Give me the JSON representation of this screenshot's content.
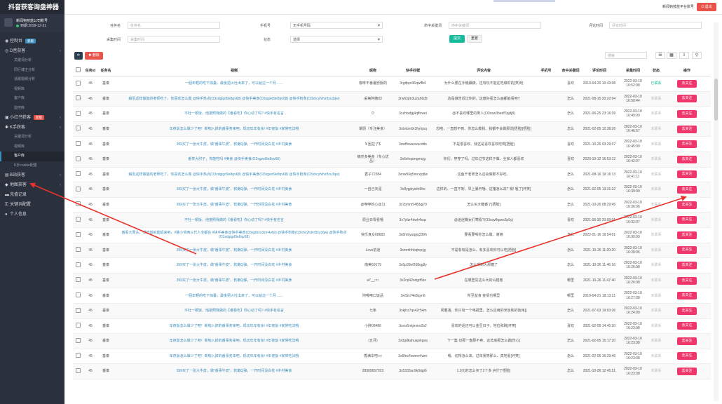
{
  "app": {
    "title": "抖音获客询盘神器"
  },
  "user": {
    "name": "新闻钩技蓝公司账号",
    "expiry": "到期:2099-12-31"
  },
  "topbar": {
    "welcome": "新闻钩技蓝平台账号",
    "logout": "退出"
  },
  "sidebar": {
    "items": [
      {
        "label": "控制台",
        "tag": "新版",
        "tag_color": "#3c8dbc"
      },
      {
        "label": "D音获客"
      },
      {
        "label": "关键词分析"
      },
      {
        "label": "同行博主分析"
      },
      {
        "label": "话题视频分析"
      },
      {
        "label": "视频库"
      },
      {
        "label": "客户库"
      },
      {
        "label": "监控库"
      },
      {
        "label": "小红书获客",
        "tag": "新版",
        "tag_color": "#e8534a"
      },
      {
        "label": "K手获客"
      },
      {
        "label": "关键词分析"
      },
      {
        "label": "视频库"
      },
      {
        "label": "客户库"
      },
      {
        "label": "K手cookie配置"
      },
      {
        "label": "B站获客"
      },
      {
        "label": "地图获客"
      },
      {
        "label": "充值记录"
      },
      {
        "label": "关键词配置"
      },
      {
        "label": "个人信息"
      }
    ]
  },
  "search": {
    "task_label": "任务名",
    "task_placeholder": "任务名",
    "phone_label": "手机号",
    "phone_value": "无手机号码",
    "keyword_label": "命中关键词",
    "keyword_placeholder": "命中关键词",
    "comment_time_label": "评论时间",
    "comment_time_placeholder": "评论时间",
    "collect_time_label": "采集时间",
    "collect_time_placeholder": "采集时间",
    "status_label": "状态",
    "status_value": "选择",
    "submit": "提交",
    "reset": "重置"
  },
  "toolbar": {
    "refresh": "⟳",
    "delete": "删除",
    "search_placeholder": "搜索"
  },
  "table": {
    "headers": [
      "",
      "任务id",
      "任务名",
      "视频",
      "昵称",
      "快手抖號",
      "评论内容",
      "手机号",
      "命中关键词",
      "评论时间",
      "采集时间",
      "状态",
      "操作"
    ],
    "action_label": "去关注",
    "rows": [
      {
        "id": "45",
        "task": "垂奏",
        "video": "一個年輕的吃下烛臺，最後把火吐出來了，可以給這一个月……",
        "nick": "咖啡不番薯舒服的",
        "uid": "3rgtfppr36qwffb4",
        "comment": "为什么要在手機續錄，还有玩不能在吃綠財的[笑哭]",
        "kw": "喜欢",
        "ctime": "2019-04-20 10:43:08",
        "gtime": "2022-03-10 16:52:08",
        "status": "已联系",
        "status_on": true
      },
      {
        "id": "45",
        "task": "垂奏",
        "video": "解氢这样做能的老师吃了，你喜欢怎么做 @快手热点(O3xdgigd9e8qv68) @快手美食(O3xgwd9e8qv68) @快手粉条(O3xhcyfvfvr8zu3qw)",
        "nick": "采斋阿姨93",
        "uid": "3rw63ph3u2a56d9",
        "comment": "这是谁告诉过你的，这盘好看怎么画都能看吧?",
        "kw": "怎么",
        "ctime": "2021-08-15 20:22:04",
        "gtime": "2022-03-10 16:50:44",
        "status": "未联系",
        "status_on": false
      },
      {
        "id": "45",
        "task": "垂奏",
        "video": "不吐一顿饭，他按照我做的【番看吃】你心动了吗? #快手有名言",
        "nick": "D",
        "uid": "3xzhtxdgj4qffowei",
        "comment": "@不喜欢哪里的男人(O3xsw3bedf7pjdj8)",
        "kw": "怎么",
        "ctime": "2021-06-25 23:16:39",
        "gtime": "2022-03-10 16:49:09",
        "status": "未联系",
        "status_on": false
      },
      {
        "id": "45",
        "task": "垂奏",
        "video": "年夜饭怎么做少了吧！新喘入掉的番事务来吧，现切年年有余! #年夜饭 #家常吃法哦",
        "nick": "掌厨（专注美食）",
        "uid": "3xbnbm9r3fyrkjsq",
        "comment": "恐啦，一直想不到、你怎么教我、我都不会做那烫[捂脸][捂脸]",
        "kw": "怎么",
        "ctime": "2021-02-05 12:38:26",
        "gtime": "2022-03-10 16:46:57",
        "status": "未联系",
        "status_on": false
      },
      {
        "id": "45",
        "task": "垂奏",
        "video": "399买了一张大牛皮，做“番事牛皮”，软嫩Q弹，一开时间没白花 #乡村美食",
        "nick": "¥ 困拉了$",
        "uid": "3xwffxwavwucdds",
        "comment": "不是很喜欢、我还是喜欢喜欢吃啊[捂脸]",
        "kw": "喜欢",
        "ctime": "2021-10-26 03:29:37",
        "gtime": "2022-03-10 16:45:09",
        "status": "未联系",
        "status_on": false
      },
      {
        "id": "45",
        "task": "垂奏",
        "video": "番茶大肘子，你能吃吗 #美食 @快手美食(O3xgwd9e8qv68)",
        "nick": "楠杰多美食（专心优品）",
        "uid": "3x6xhqamgmcjg",
        "comment": "你们，穿穿了吗，过年过节这样子做、全家人都喜欢",
        "kw": "喜欢",
        "ctime": "2020-10-12 16:53:12",
        "gtime": "2022-03-10 16:42:07",
        "status": "未联系",
        "status_on": false
      },
      {
        "id": "45",
        "task": "垂奏",
        "video": "解氢这样做能的老师吃了，你喜欢怎么做 @快手热点(O3xdgigd9e8qv68) @快手美食(O3xgwd9e8qv68) @快手粉条(O3xhcyfvfvr8zu3qw)",
        "nick": "君子72384",
        "uid": "3xnw56q5mcxjq8w",
        "comment": "这鱼干老师怎么这会做那不好吃。",
        "kw": "怎么",
        "ctime": "2021-08-16 19:16:13",
        "gtime": "2022-03-10 16:41:11",
        "status": "未联系",
        "status_on": false
      },
      {
        "id": "45",
        "task": "垂奏",
        "video": "399买了一张大牛皮，做“番事牛皮”，软嫩Q弹，一开时间没白花 #乡村美食",
        "nick": "一自己天涯",
        "uid": "3x8ygpiyisht9he",
        "comment": "这样的、一直不到、早上暴开哦、这猪怎么来? 嘿! 喔了[坏笑]",
        "kw": "怎么",
        "ctime": "2021-02-05 13:31:22",
        "gtime": "2022-03-10 16:39:09",
        "status": "未联系",
        "status_on": false
      },
      {
        "id": "45",
        "task": "垂奏",
        "video": "399买了一张大牛皮，做“番事牛皮”，软嫩Q弹，一开时间没白花 #乡村美食",
        "nick": "@咿咿的心@11",
        "uid": "3x7pmm5483gj79",
        "comment": "怎么买大糖番了[捂脸]",
        "kw": "怎么",
        "ctime": "2021-10-26 08:29:45",
        "gtime": "2022-03-10 16:36:06",
        "status": "未联系",
        "status_on": false
      },
      {
        "id": "45",
        "task": "垂奏",
        "video": "不吐一顿饭，他按照我做的【番看吃】你心动了吗? #快手有名言",
        "nick": "原业日零看嘻",
        "uid": "3x7yfzr4dwh4sqc",
        "comment": "@迷迷糊女们莺看?(O3xqvfkpws2p9y)",
        "kw": "喜欢",
        "ctime": "2021-06-30 20:09:01",
        "gtime": "2022-03-10 16:32:07",
        "status": "未联系",
        "status_on": false
      },
      {
        "id": "45",
        "task": "垂奏",
        "video": "番看大果头，想吃饭就能起来吧，#整小爷两三代人全都在 #快手美食@快手美食(O3xgtbxx3xm4yfw) @快手粉条(O3xhcyfvfvr8zu3qw) @快手热点(O3xdgigd9e8qv68)",
        "nick": "快乐真女68683",
        "uid": "3x8mbyuqgq339h",
        "comment": "要看要喝你怎么做、谢谢",
        "kw": "怎么",
        "ctime": "2022-01-16 19:54:01",
        "gtime": "2022-03-10 16:30:09",
        "status": "未联系",
        "status_on": false
      },
      {
        "id": "45",
        "task": "垂奏",
        "video": "399买了一张大牛皮，做“番事牛皮”，软嫩Q弹，一开时间没白花 #乡村美食",
        "nick": "Love前道",
        "uid": "3xmmhhbqhqcjg",
        "comment": "不是有有是怎么，有多喜欢你可以吃[捂脸]",
        "kw": "怎么",
        "ctime": "2021-10-26 11:20:20",
        "gtime": "2022-03-10 16:28:06",
        "status": "未联系",
        "status_on": false
      },
      {
        "id": "45",
        "task": "垂奏",
        "video": "399买了一张大牛皮，做“番事牛皮”，软嫩Q弹，一开时间没白花 #乡村美食",
        "nick": "南美59179",
        "uid": "3x5p39nf268qg8y",
        "comment": "怎么喝到大那糖了",
        "kw": "怎么",
        "ctime": "2021-10-26 11:46:16",
        "gtime": "2022-03-10 16:26:08",
        "status": "未联系",
        "status_on": false
      },
      {
        "id": "45",
        "task": "垂奏",
        "video": "399买了一张大牛皮，做“番事牛皮”，软嫩Q弹，一开时间没白花 #乡村美食",
        "nick": "a7__□□",
        "uid": "3x2cp42sdgd5bx",
        "comment": "在哪里买这么大的山楂卷",
        "kw": "哪里",
        "ctime": "2021-10-26 11:47:40",
        "gtime": "2022-03-10 16:26:08",
        "status": "未联系",
        "status_on": false
      },
      {
        "id": "45",
        "task": "垂奏",
        "video": "一個年輕的吃下烛臺，最後把火吐出來了，可以給這一个月……",
        "nick": "阿哦嗦口饭品",
        "uid": "3xr5ix74e8qyn6",
        "comment": "所至盆食 金情也哪里",
        "kw": "哪里",
        "ctime": "2019-04-21 18:13:21",
        "gtime": "2022-03-10 16:27:08",
        "status": "未联系",
        "status_on": false
      },
      {
        "id": "45",
        "task": "垂奏",
        "video": "不吐一顿饭，他按照我做的【番看吃】你心动了吗? #快手有名言",
        "nick": "七条",
        "uid": "3xkjhz7qs42r54m",
        "comment": "闲着凑、你只有一个电视里，怎么应用的米饭和的饭用[]",
        "kw": "怎么",
        "ctime": "2021-07-03 19:03:36",
        "gtime": "2022-03-10 16:24:09",
        "status": "未联系",
        "status_on": false
      },
      {
        "id": "45",
        "task": "垂奏",
        "video": "年夜饭怎么做少了吧！新喘入掉的番事务来吧，现切年年有余! #年夜饭 #家常吃法哦",
        "nick": "小胖08486",
        "uid": "3xmr5nkjmmx2b2",
        "comment": "喜欢的话还可以金豆日子，地位和碗[坏笑]",
        "kw": "喜欢",
        "ctime": "2021-02-05 14:40:20",
        "gtime": "2022-03-10 16:23:08",
        "status": "未联系",
        "status_on": false
      },
      {
        "id": "45",
        "task": "垂奏",
        "video": "年夜饭怎么做少了吧！新喘入掉的番事务来吧，现切年年有余! #年夜饭 #家常吃法哦",
        "nick": "(五月)",
        "uid": "3x3gdkahuajvkgsq",
        "comment": "下一集 切那一盘那不卖、这年底那怎么做[伤心]",
        "kw": "怎么",
        "ctime": "2021-02-05 15:17:20",
        "gtime": "2022-03-10 16:23:08",
        "status": "未联系",
        "status_on": false
      },
      {
        "id": "45",
        "task": "垂奏",
        "video": "年夜饭怎么做少了吧！新喘入掉的番事务来吧，现切年年有余! #年夜饭 #家常吃法哦",
        "nick": "香满华吧□□",
        "uid": "3x5fnc4xwme4wre",
        "comment": "嗯、切得怎么来，过年我等那么、真地看[坏笑]",
        "kw": "怎么",
        "ctime": "2021-02-05 15:29:46",
        "gtime": "2022-03-10 16:23:08",
        "status": "未联系",
        "status_on": false
      },
      {
        "id": "45",
        "task": "垂奏",
        "video": "399买了一张大牛皮，做“番事牛皮”，软嫩Q弹，一开时间没白花 #乡村美食",
        "nick": "28909657923",
        "uid": "3x5333xn9k0dgt6",
        "comment": "1.9元的怎么买了2个多 [4付了捂脸]",
        "kw": "怎么",
        "ctime": "2021-10-26 12:45:51",
        "gtime": "2022-03-10 16:23:08",
        "status": "未联系",
        "status_on": false
      }
    ]
  }
}
